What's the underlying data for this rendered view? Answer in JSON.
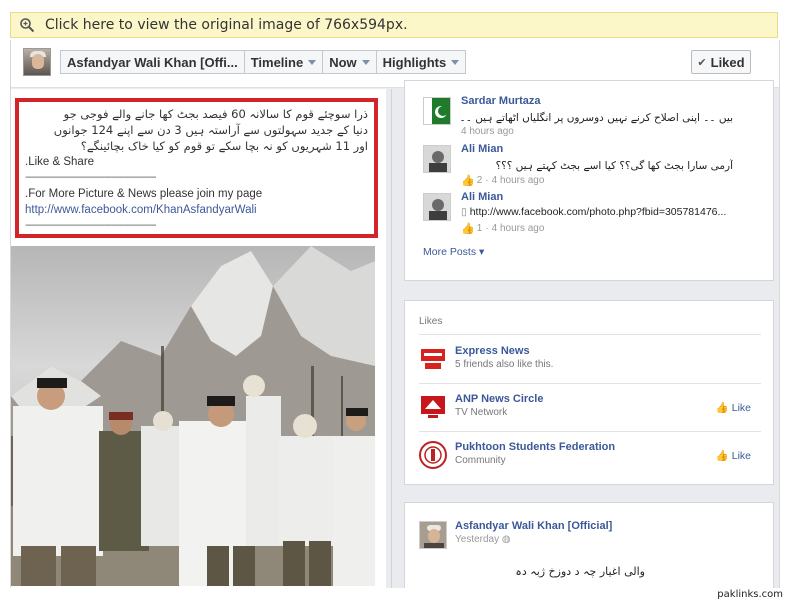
{
  "notice": {
    "text": "Click here to view the original image of 766x594px."
  },
  "topbar": {
    "page_name": "Asfandyar Wali Khan [Offi...",
    "timeline": "Timeline",
    "now": "Now",
    "highlights": "Highlights",
    "liked": "Liked"
  },
  "post": {
    "urdu_line1": "ذرا سوچئے قوم کا سالانہ 60 فیصد بجٹ کھا جانے والے فوجی جو",
    "urdu_line2": "دنیا کے جدید سہولتوں سے آراستہ ہیں 3 دن سے اپنے 124 جوانوں",
    "urdu_line3": "اور 11 شہریوں کو نہ بچا سکے تو قوم کو کیا خاک بچائینگے؟",
    "like_share": ".Like & Share",
    "separator": "--------------------------------------------------------",
    "join_text": ".For More Picture & News please join my page",
    "link": "http://www.facebook.com/KhanAsfandyarWali",
    "separator2": "--------------------------------------------------------"
  },
  "comments": [
    {
      "name": "Sardar Murtaza",
      "text": "بیں ۔۔ اپنی اصلاح کرنے نہیں دوسروں پر انگلیاں اٹھاتے ہیں ۔۔",
      "likes": "",
      "time": "4 hours ago"
    },
    {
      "name": "Ali Mian",
      "text": "آرمی سارا بجٹ کھا گی؟؟ کیا اسے بجٹ کہتے ہیں ؟؟؟",
      "likes": "2",
      "time": "4 hours ago"
    },
    {
      "name": "Ali Mian",
      "text": "http://www.facebook.com/photo.php?fbid=305781476...",
      "likes": "1",
      "time": "4 hours ago"
    }
  ],
  "more_posts": "More Posts",
  "likes_section": {
    "title": "Likes",
    "items": [
      {
        "name": "Express News",
        "sub": "5 friends also like this.",
        "like_label": ""
      },
      {
        "name": "ANP News Circle",
        "sub": "TV Network",
        "like_label": "Like"
      },
      {
        "name": "Pukhtoon Students Federation",
        "sub": "Community",
        "like_label": "Like"
      }
    ]
  },
  "bottom_post": {
    "name": "Asfandyar Wali Khan [Official]",
    "meta": "Yesterday",
    "text": "والی اغیار چہ د دوزخ ژبہ دہ"
  },
  "footer": {
    "site": "paklinks.com"
  },
  "colors": {
    "link": "#3b5998",
    "highlight_border": "#d2252a",
    "notice_bg": "#fbf7c8"
  }
}
